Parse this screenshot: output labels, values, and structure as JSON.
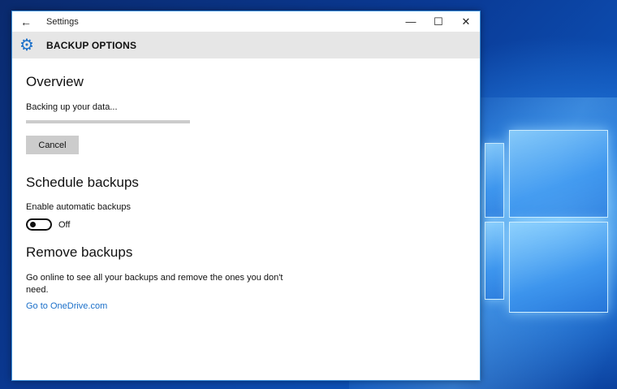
{
  "window": {
    "app_title": "Settings",
    "back_icon": "back-arrow-icon",
    "controls": [
      "minimize-icon",
      "maximize-icon",
      "close-icon"
    ]
  },
  "header": {
    "icon": "gear-icon",
    "title": "BACKUP OPTIONS",
    "icon_color": "#1a6fc9"
  },
  "overview": {
    "title": "Overview",
    "status": "Backing up your data...",
    "progress": 0,
    "cancel_label": "Cancel"
  },
  "schedule": {
    "title": "Schedule backups",
    "toggle_label": "Enable automatic backups",
    "toggle_state": "Off",
    "toggle_on": false
  },
  "remove": {
    "title": "Remove backups",
    "description": "Go online to see all your backups and remove the ones you don't need.",
    "link_label": "Go to OneDrive.com",
    "link_color": "#1a6fc9"
  }
}
